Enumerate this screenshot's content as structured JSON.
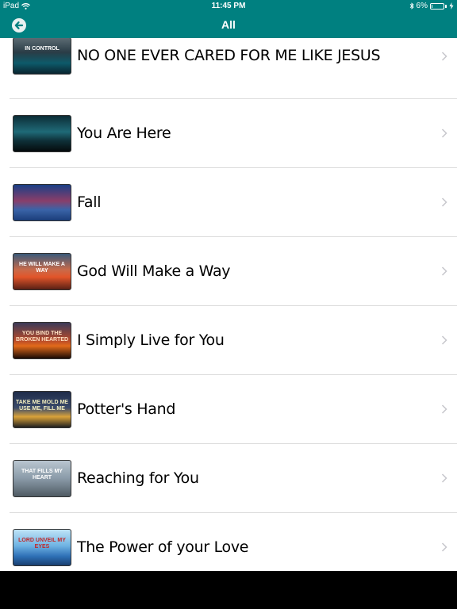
{
  "status_bar": {
    "device": "iPad",
    "time": "11:45 PM",
    "battery": "6%",
    "battery_level": 0.06
  },
  "nav": {
    "title": "All",
    "back_icon": "back-arrow-icon"
  },
  "colors": {
    "accent": "#008080",
    "separator": "#dcdcdc",
    "chevron": "#c7c7cc"
  },
  "songs": [
    {
      "title": "NO ONE EVER CARED FOR ME LIKE JESUS",
      "thumb_caption": "IN CONTROL"
    },
    {
      "title": "You Are Here",
      "thumb_caption": ""
    },
    {
      "title": "Fall",
      "thumb_caption": ""
    },
    {
      "title": "God Will Make a Way",
      "thumb_caption": "HE WILL MAKE A WAY"
    },
    {
      "title": "I Simply Live for You",
      "thumb_caption": "YOU BIND THE BROKEN HEARTED"
    },
    {
      "title": "Potter's Hand",
      "thumb_caption": "TAKE ME MOLD ME USE ME, FILL ME"
    },
    {
      "title": "Reaching for You",
      "thumb_caption": "THAT FILLS MY HEART"
    },
    {
      "title": "The Power of your Love",
      "thumb_caption": "LORD UNVEIL MY EYES"
    }
  ]
}
